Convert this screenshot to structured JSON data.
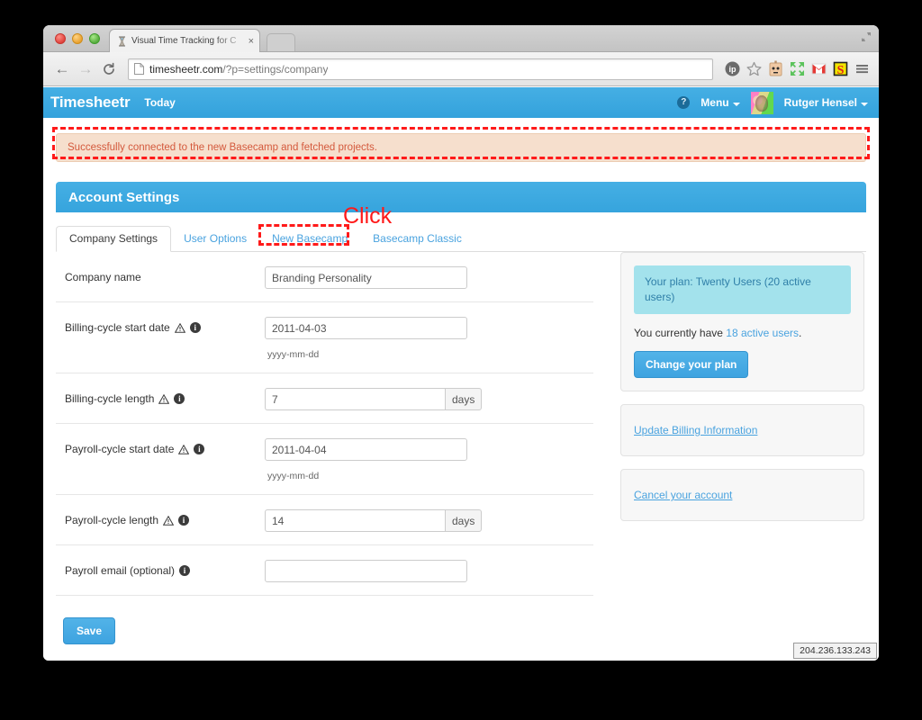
{
  "browser": {
    "tab": {
      "title": "Visual Time Tracking for C",
      "favicon": "hourglass-icon",
      "close": "×"
    },
    "nav": {
      "back": "←",
      "forward": "→",
      "reload": "↻"
    },
    "omnibox": {
      "url_main": "timesheetr.com",
      "url_path": "/?p=settings/company"
    },
    "toolbar_icons": [
      "ip-badge-icon",
      "bookmark-star-icon",
      "robot-extension-icon",
      "fullscreen-arrows-icon",
      "gmail-icon",
      "s-extension-icon",
      "chrome-menu-icon"
    ]
  },
  "app_header": {
    "brand": "Timesheetr",
    "nav_today": "Today",
    "help": "?",
    "menu_label": "Menu",
    "user_label": "Rutger Hensel"
  },
  "alert": {
    "message": "Successfully connected to the new Basecamp and fetched projects."
  },
  "panel": {
    "title": "Account Settings"
  },
  "tabs": [
    {
      "label": "Company Settings",
      "active": true
    },
    {
      "label": "User Options",
      "active": false
    },
    {
      "label": "New Basecamp",
      "active": false
    },
    {
      "label": "Basecamp Classic",
      "active": false
    }
  ],
  "form": {
    "rows": [
      {
        "label": "Company name",
        "warn": false,
        "info": true,
        "value": "Branding Personality",
        "placeholder": "",
        "addon": "",
        "hint": ""
      },
      {
        "label": "Billing-cycle start date",
        "warn": true,
        "info": true,
        "value": "2011-04-03",
        "placeholder": "",
        "addon": "",
        "hint": "yyyy-mm-dd"
      },
      {
        "label": "Billing-cycle length",
        "warn": true,
        "info": true,
        "value": "7",
        "placeholder": "",
        "addon": "days",
        "hint": ""
      },
      {
        "label": "Payroll-cycle start date",
        "warn": true,
        "info": true,
        "value": "2011-04-04",
        "placeholder": "",
        "addon": "",
        "hint": "yyyy-mm-dd"
      },
      {
        "label": "Payroll-cycle length",
        "warn": true,
        "info": true,
        "value": "14",
        "placeholder": "",
        "addon": "days",
        "hint": ""
      },
      {
        "label": "Payroll email (optional)",
        "warn": false,
        "info": true,
        "value": "",
        "placeholder": "",
        "addon": "",
        "hint": ""
      }
    ],
    "save_label": "Save"
  },
  "sidebar": {
    "plan_badge": "Your plan: Twenty Users (20 active users)",
    "active_prefix": "You currently have ",
    "active_link": "18 active users",
    "active_suffix": ".",
    "change_plan_label": "Change your plan",
    "links": [
      {
        "label": "Update Billing Information"
      },
      {
        "label": "Cancel your account"
      }
    ]
  },
  "status": {
    "ip_address": "204.236.133.243"
  },
  "annotations": {
    "click_label": "Click"
  },
  "colors": {
    "brand_blue": "#3fa9e0",
    "link_blue": "#4aa3df",
    "alert_bg": "#f6dfcd",
    "alert_text": "#d4593c",
    "annotation_red": "#ff1a1a",
    "plan_badge_bg": "#a3e2ec"
  }
}
